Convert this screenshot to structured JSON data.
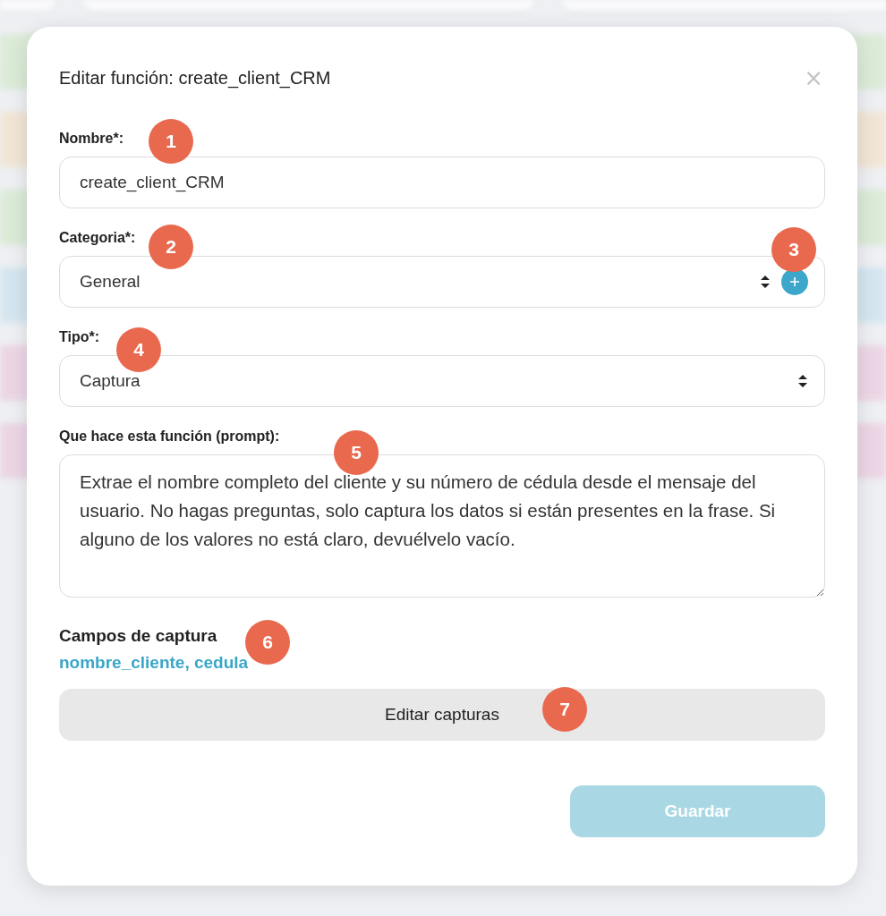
{
  "background": {
    "rows": [
      {
        "color": "#dcebd8"
      },
      {
        "color": "#f1e6d6"
      },
      {
        "color": "#dcebd8"
      },
      {
        "color": "#d5e6f0"
      },
      {
        "color": "#ecd6e6"
      },
      {
        "color": "#ecd6e6"
      }
    ]
  },
  "dialog": {
    "title": "Editar función: create_client_CRM",
    "close": "×",
    "fields": [
      {
        "kind": "input",
        "label": "Nombre*:",
        "value": "create_client_CRM",
        "annotation": "1"
      },
      {
        "kind": "select",
        "label": "Categoria*:",
        "value": "General",
        "annotation": "2",
        "add_button": true,
        "add_annotation": "3"
      },
      {
        "kind": "select",
        "label": "Tipo*:",
        "value": "Captura",
        "annotation": "4"
      },
      {
        "kind": "textarea",
        "label": "Que hace esta función (prompt):",
        "value": "Extrae el nombre completo del cliente y su número de cédula desde el mensaje del usuario. No hagas preguntas, solo captura los datos si están presentes en la frase. Si alguno de los valores no está claro, devuélvelo vacío.",
        "annotation": "5"
      }
    ],
    "capture": {
      "heading": "Campos de captura",
      "annotation": "6",
      "fields_text": "nombre_cliente, cedula",
      "edit_button": "Editar capturas",
      "edit_annotation": "7"
    },
    "save_button": {
      "label": "Guardar",
      "disabled": true
    }
  }
}
